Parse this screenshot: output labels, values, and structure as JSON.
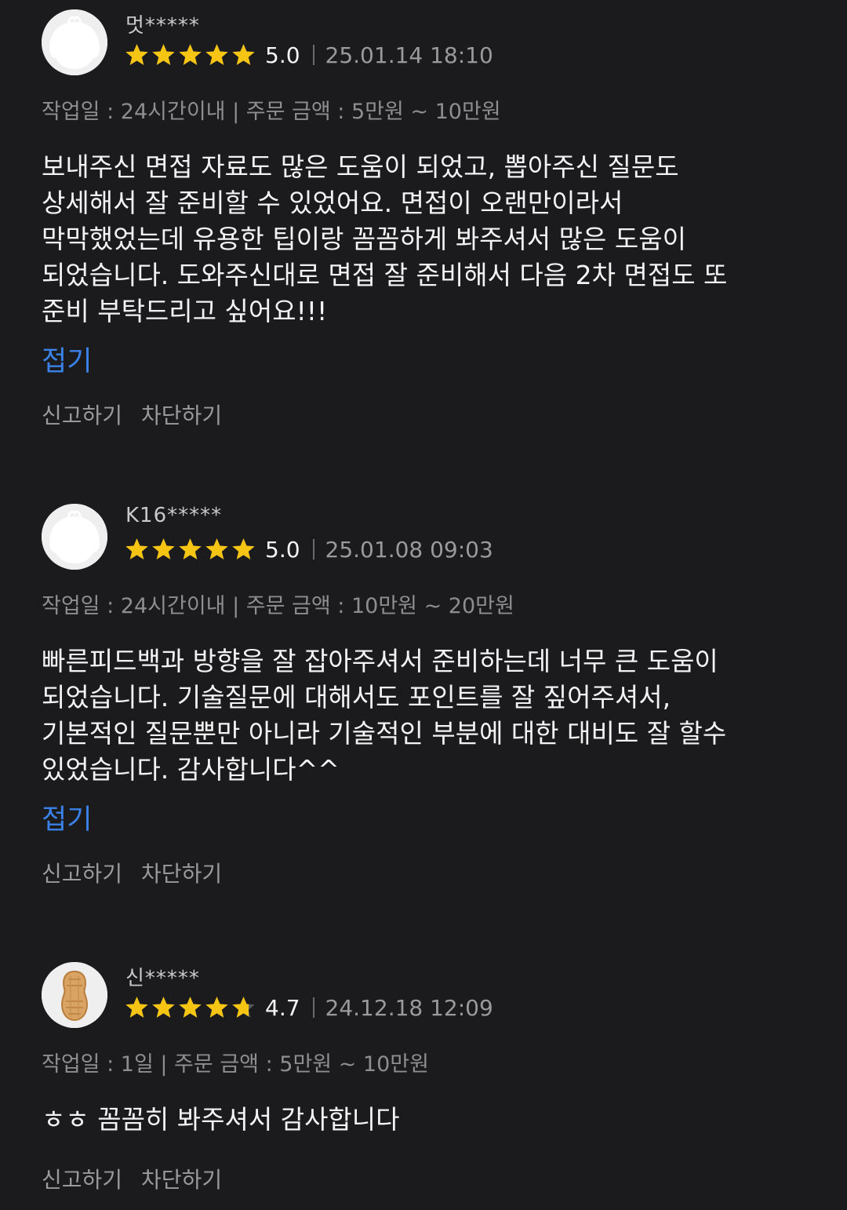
{
  "colors": {
    "background": "#1b1b1d",
    "star": "#f6c514",
    "link": "#3b82e8",
    "meta_text": "#8e8e8e"
  },
  "reviews": [
    {
      "avatar_icon": "default-profile-icon",
      "author": "멋*****",
      "rating": 5.0,
      "score_text": "5.0",
      "date": "25.01.14 18:10",
      "meta": "작업일 : 24시간이내 | 주문 금액 : 5만원 ~ 10만원",
      "body": "보내주신 면접 자료도 많은 도움이 되었고, 뽑아주신 질문도\n상세해서 잘 준비할 수 있었어요. 면접이 오랜만이라서\n막막했었는데 유용한 팁이랑 꼼꼼하게 봐주셔서 많은 도움이\n되었습니다. 도와주신대로 면접 잘 준비해서 다음 2차 면접도 또\n준비 부탁드리고 싶어요!!!",
      "fold_label": "접기",
      "report_label": "신고하기",
      "block_label": "차단하기"
    },
    {
      "avatar_icon": "default-profile-icon",
      "author": "K16*****",
      "rating": 5.0,
      "score_text": "5.0",
      "date": "25.01.08 09:03",
      "meta": "작업일 : 24시간이내 | 주문 금액 : 10만원 ~ 20만원",
      "body": "빠른피드백과 방향을 잘 잡아주셔서 준비하는데 너무 큰 도움이\n되었습니다. 기술질문에 대해서도 포인트를 잘 짚어주셔서,\n기본적인 질문뿐만 아니라 기술적인 부분에 대한 대비도 잘 할수\n있었습니다. 감사합니다^^",
      "fold_label": "접기",
      "report_label": "신고하기",
      "block_label": "차단하기"
    },
    {
      "avatar_icon": "peanut-icon",
      "author": "신*****",
      "rating": 4.7,
      "score_text": "4.7",
      "date": "24.12.18 12:09",
      "meta": "작업일 : 1일 | 주문 금액 : 5만원 ~ 10만원",
      "body": "ㅎㅎ 꼼꼼히 봐주셔서 감사합니다",
      "report_label": "신고하기",
      "block_label": "차단하기"
    }
  ]
}
